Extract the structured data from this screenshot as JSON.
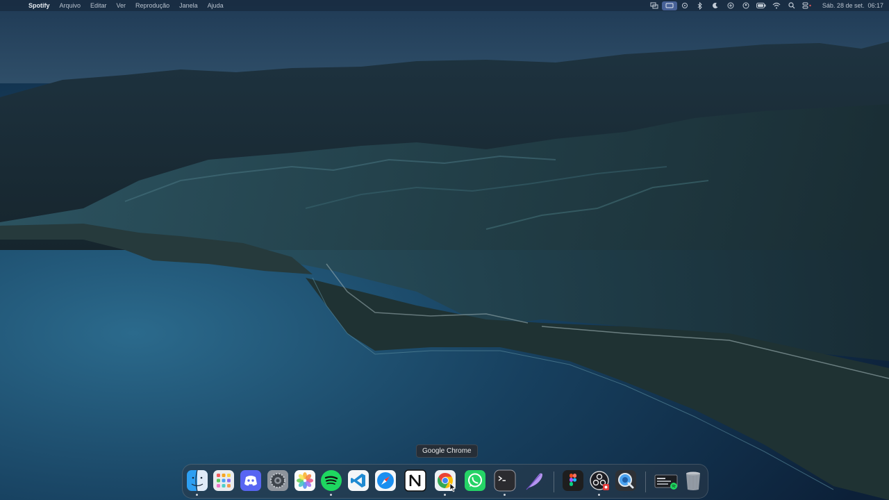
{
  "menubar": {
    "apple_glyph": "",
    "app_name": "Spotify",
    "menus": [
      "Arquivo",
      "Editar",
      "Ver",
      "Reprodução",
      "Janela",
      "Ajuda"
    ],
    "tray_icons": [
      "screen-mirror-icon",
      "display-icon",
      "bolt-icon",
      "bluetooth-icon",
      "moon-icon",
      "plus-circle-icon",
      "user-circle-icon",
      "battery-icon",
      "wifi-icon",
      "search-icon",
      "control-center-icon"
    ],
    "date": "Sáb. 28 de set.",
    "time": "06:17"
  },
  "tooltip": {
    "text": "Google Chrome"
  },
  "dock": {
    "apps": [
      {
        "name": "Finder",
        "icon": "finder-icon",
        "running": true
      },
      {
        "name": "Launchpad",
        "icon": "launchpad-icon",
        "running": false
      },
      {
        "name": "Discord",
        "icon": "discord-icon",
        "running": false
      },
      {
        "name": "System Settings",
        "icon": "settings-gear-icon",
        "running": false
      },
      {
        "name": "Photos",
        "icon": "photos-icon",
        "running": false
      },
      {
        "name": "Spotify",
        "icon": "spotify-icon",
        "running": true
      },
      {
        "name": "Visual Studio Code",
        "icon": "vscode-icon",
        "running": false
      },
      {
        "name": "Safari",
        "icon": "safari-compass-icon",
        "running": false
      },
      {
        "name": "Notion",
        "icon": "notion-icon",
        "running": false
      },
      {
        "name": "Google Chrome",
        "icon": "chrome-icon",
        "running": true
      },
      {
        "name": "WhatsApp",
        "icon": "whatsapp-icon",
        "running": false
      },
      {
        "name": "Terminal",
        "icon": "terminal-icon",
        "running": true
      },
      {
        "name": "Quill",
        "icon": "feather-icon",
        "running": false
      },
      {
        "name": "Figma",
        "icon": "figma-icon",
        "running": false
      },
      {
        "name": "OBS Studio",
        "icon": "obs-icon",
        "running": true
      },
      {
        "name": "QuickTime Player",
        "icon": "quicktime-icon",
        "running": false
      },
      {
        "name": "Recent window",
        "icon": "window-thumbnail-icon",
        "running": false
      },
      {
        "name": "Trash",
        "icon": "trash-icon",
        "running": false
      }
    ]
  },
  "colors": {
    "sky": "#2a4660",
    "ocean": "#16385a",
    "land": "#1b2e36",
    "spotify_green": "#1ed760",
    "chrome_red": "#ea4335"
  }
}
